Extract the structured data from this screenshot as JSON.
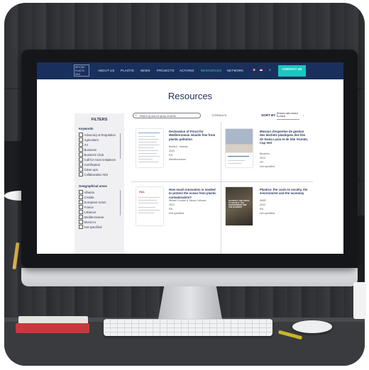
{
  "nav": {
    "logo": "BEYOND PLASTIC MED",
    "items": [
      "ABOUT US",
      "PLASTIC",
      "NEWS",
      "PROJECTS",
      "ACTIONS",
      "RESOURCES",
      "NETWORK"
    ],
    "active_index": 5,
    "contact": "CONTACT US"
  },
  "page_title": "Resources",
  "filters": {
    "heading": "FILTERS",
    "keywords_heading": "Keywords",
    "keywords": [
      "Advocacy & Regulation",
      "Agriculture",
      "Art",
      "Business",
      "Business Club",
      "Call for micro-initiatives",
      "Certification",
      "Clean ups",
      "Collaboration N/S"
    ],
    "geo_heading": "Geographical areas",
    "geo": [
      "Albania",
      "Croatia",
      "European Union",
      "France",
      "Lebanon",
      "Mediterranean",
      "Morocco",
      "Not specified"
    ]
  },
  "search": {
    "placeholder": "Search by word or group of words"
  },
  "results_count": "73 RESULTS",
  "sort": {
    "label": "SORT BY :",
    "value": "Release date newest to oldest"
  },
  "cards": [
    {
      "title": "Declaration of Frioul for Mediterranean islands free from plastic pollution",
      "meta": [
        "BeMed - Islands",
        "2023",
        "EN",
        "Mediterranean"
      ]
    },
    {
      "title": "Mission d'expertise de gestion des déchets plastiques des îles de Santa Luzia et de São Vicente, Cap Vert",
      "meta": [
        "Biosfera",
        "2023",
        "FR",
        "Not specified"
      ]
    },
    {
      "title": "How much innovation is needed to protect the ocean from plastic contamination?",
      "meta": [
        "Melani Cordier & Takuro Uehara",
        "2022",
        "EN",
        "Not specified"
      ]
    },
    {
      "title": "Plastics: the costs to society, the environment and the economy",
      "meta": [
        "WWF",
        "2021",
        "EN",
        "Not specified"
      ]
    }
  ],
  "thumb_texts": {
    "hal": "HAL",
    "wwf_cover": "PLASTICS: THE COSTS TO SOCIETY, THE ENVIRONMENT AND THE ECONOMY"
  },
  "colors": {
    "nav_bg": "#19305e",
    "accent": "#17c8c0",
    "title": "#1d2e55"
  }
}
